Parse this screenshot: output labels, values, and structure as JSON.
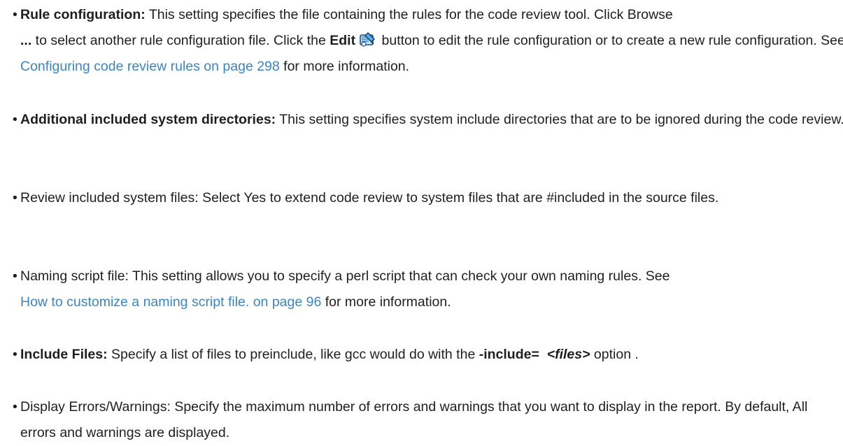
{
  "items": [
    {
      "term": "Rule configuration:",
      "text_before_browse": " This setting specifies the file containing the rules for the code review tool. Click Browse",
      "browse_ellipsis": "...",
      "text_before_edit": " to select another rule configuration file. Click the ",
      "edit_label": "Edit",
      "edit_icon": "edit-rules-icon",
      "text_after_edit": " button to edit the rule configuration or to create a new rule configuration. See ",
      "link_text": "Configuring code review rules on page 298",
      "text_after_link": " for more information."
    },
    {
      "term": "Additional included system directories:",
      "text": " This setting specifies system include directories that are to be ignored during the code review."
    },
    {
      "text": "Review included system files: Select Yes to extend code review to system files that are #included in the source files."
    },
    {
      "text_before_link": "Naming script file: This setting allows you to specify a perl script that can check your own naming rules. See ",
      "link_text": "How to customize a naming script file. on page 96",
      "text_after_link": " for more information."
    },
    {
      "term": "Include Files:",
      "text_before_option": " Specify a list of files to preinclude, like gcc would do with the ",
      "option": "-include=",
      "option_arg": "<files>",
      "text_after_option": "  option ."
    },
    {
      "text": "Display Errors/Warnings: Specify the maximum number of errors and warnings that you want to display in the report. By default, All errors and warnings are displayed."
    }
  ],
  "bullet": "•",
  "colors": {
    "text": "#1f1f1f",
    "link": "#3b86c2"
  }
}
